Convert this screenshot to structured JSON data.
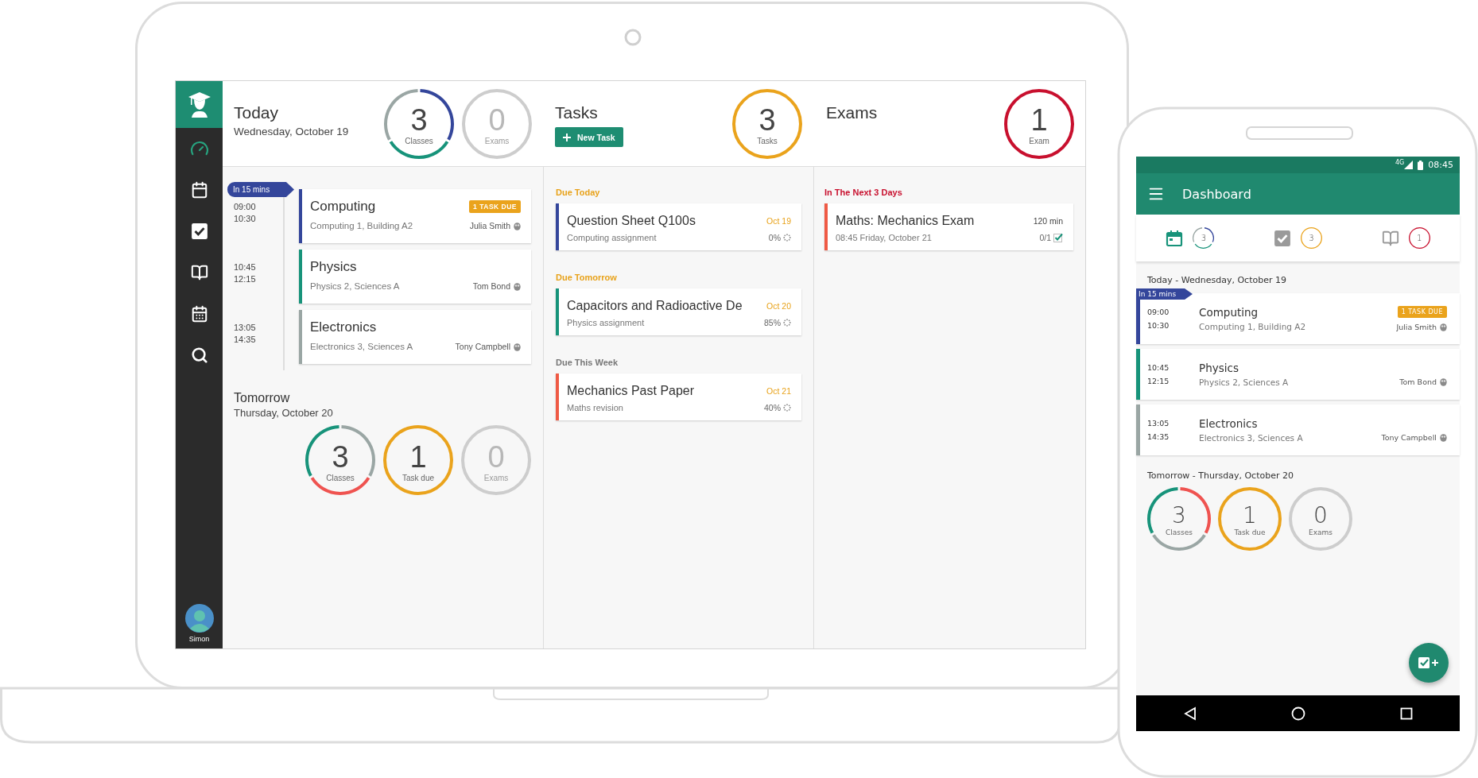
{
  "laptop": {
    "sidebar": {
      "nav": [
        {
          "kind": "dashboard",
          "selected": true
        },
        {
          "kind": "calendar",
          "selected": false
        },
        {
          "kind": "tasks",
          "selected": false
        },
        {
          "kind": "exams",
          "selected": false
        },
        {
          "kind": "timetable",
          "selected": false
        },
        {
          "kind": "search",
          "selected": false
        }
      ],
      "user": {
        "name": "Simon"
      }
    },
    "today": {
      "title": "Today",
      "date": "Wednesday, October 19",
      "rings": [
        {
          "value": "3",
          "label": "Classes",
          "muted": false,
          "segments": [
            {
              "color": "#34469b"
            },
            {
              "color": "#17937a"
            },
            {
              "color": "#9aa6a4"
            }
          ]
        },
        {
          "value": "0",
          "label": "Exams",
          "muted": true,
          "segments": [
            {
              "color": "#cdcdcd"
            }
          ]
        }
      ],
      "flag": "In 15 mins",
      "classes": [
        {
          "start": "09:00",
          "end": "10:30",
          "title": "Computing",
          "location": "Computing 1, Building A2",
          "teacher": "Julia Smith",
          "badge": "1 TASK DUE",
          "color": "#34469b"
        },
        {
          "start": "10:45",
          "end": "12:15",
          "title": "Physics",
          "location": "Physics 2, Sciences A",
          "teacher": "Tom Bond",
          "color": "#17937a"
        },
        {
          "start": "13:05",
          "end": "14:35",
          "title": "Electronics",
          "location": "Electronics 3, Sciences A",
          "teacher": "Tony Campbell",
          "color": "#9aa6a4"
        }
      ]
    },
    "tomorrow": {
      "title": "Tomorrow",
      "date": "Thursday, October 20",
      "rings": [
        {
          "value": "3",
          "label": "Classes",
          "muted": false,
          "segments": [
            {
              "color": "#9aa6a4"
            },
            {
              "color": "#ef5350"
            },
            {
              "color": "#17937a"
            }
          ]
        },
        {
          "value": "1",
          "label": "Task due",
          "muted": false,
          "segments": [
            {
              "color": "#eaa31c"
            }
          ]
        },
        {
          "value": "0",
          "label": "Exams",
          "muted": true,
          "segments": [
            {
              "color": "#cdcdcd"
            }
          ]
        }
      ]
    },
    "tasks": {
      "title": "Tasks",
      "new_button": "New Task",
      "ring": {
        "value": "3",
        "label": "Tasks",
        "muted": false,
        "segments": [
          {
            "color": "#eaa31c"
          }
        ]
      },
      "groups": [
        {
          "heading": "Due Today",
          "color": "#e8a21a",
          "items": [
            {
              "title": "Question Sheet Q100s",
              "subject": "Computing assignment",
              "due": "Oct 19",
              "progress": "0%",
              "color": "#34469b"
            }
          ]
        },
        {
          "heading": "Due Tomorrow",
          "color": "#e8a21a",
          "items": [
            {
              "title": "Capacitors and Radioactive De",
              "subject": "Physics assignment",
              "due": "Oct 20",
              "progress": "85%",
              "color": "#17937a"
            }
          ]
        },
        {
          "heading": "Due This Week",
          "color": "#777777",
          "items": [
            {
              "title": "Mechanics Past Paper",
              "subject": "Maths revision",
              "due": "Oct 21",
              "progress": "40%",
              "color": "#ef5a45"
            }
          ]
        }
      ]
    },
    "exams": {
      "title": "Exams",
      "ring": {
        "value": "1",
        "label": "Exam",
        "muted": false,
        "segments": [
          {
            "color": "#c8102e"
          }
        ]
      },
      "groups": [
        {
          "heading": "In The Next 3 Days",
          "color": "#c8102e",
          "items": [
            {
              "title": "Maths: Mechanics Exam",
              "when": "08:45 Friday, October 21",
              "duration": "120 min",
              "progress": "0/1",
              "color": "#ef5a45"
            }
          ]
        }
      ]
    }
  },
  "phone": {
    "status_bar": {
      "network": "4G",
      "time": "08:45"
    },
    "app_bar": {
      "title": "Dashboard"
    },
    "summary": [
      {
        "kind": "calendar",
        "ring": {
          "value": "3",
          "muted": false,
          "segments": [
            {
              "color": "#34469b"
            },
            {
              "color": "#17937a"
            },
            {
              "color": "#9aa6a4"
            }
          ]
        }
      },
      {
        "kind": "tasks",
        "ring": {
          "value": "3",
          "muted": false,
          "segments": [
            {
              "color": "#eaa31c"
            }
          ]
        }
      },
      {
        "kind": "exams",
        "ring": {
          "value": "1",
          "muted": false,
          "segments": [
            {
              "color": "#c8102e"
            }
          ]
        }
      }
    ],
    "today": {
      "heading": "Today - Wednesday, October 19",
      "flag": "In 15 mins",
      "classes": [
        {
          "start": "09:00",
          "end": "10:30",
          "title": "Computing",
          "location": "Computing 1, Building A2",
          "teacher": "Julia Smith",
          "badge": "1 TASK DUE",
          "color": "#34469b"
        },
        {
          "start": "10:45",
          "end": "12:15",
          "title": "Physics",
          "location": "Physics 2, Sciences A",
          "teacher": "Tom Bond",
          "color": "#17937a"
        },
        {
          "start": "13:05",
          "end": "14:35",
          "title": "Electronics",
          "location": "Electronics 3, Sciences A",
          "teacher": "Tony Campbell",
          "color": "#9aa6a4"
        }
      ]
    },
    "tomorrow": {
      "heading": "Tomorrow - Thursday, October 20",
      "rings": [
        {
          "value": "3",
          "label": "Classes",
          "muted": false,
          "segments": [
            {
              "color": "#ef5350"
            },
            {
              "color": "#9aa6a4"
            },
            {
              "color": "#17937a"
            }
          ]
        },
        {
          "value": "1",
          "label": "Task due",
          "muted": false,
          "segments": [
            {
              "color": "#eaa31c"
            }
          ]
        },
        {
          "value": "0",
          "label": "Exams",
          "muted": false,
          "segments": [
            {
              "color": "#cdcdcd"
            }
          ]
        }
      ]
    }
  }
}
